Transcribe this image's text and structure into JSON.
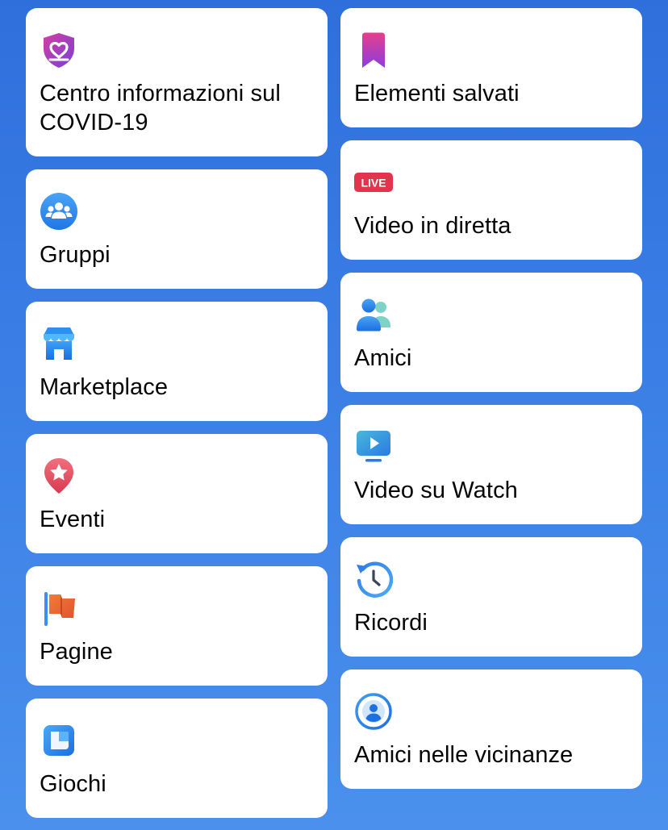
{
  "left_column": [
    {
      "label": "Centro informazioni sul COVID-19",
      "icon": "covid-shield-heart-icon"
    },
    {
      "label": "Gruppi",
      "icon": "groups-icon"
    },
    {
      "label": "Marketplace",
      "icon": "marketplace-shop-icon"
    },
    {
      "label": "Eventi",
      "icon": "events-star-pin-icon"
    },
    {
      "label": "Pagine",
      "icon": "pages-flag-icon"
    },
    {
      "label": "Giochi",
      "icon": "games-icon"
    }
  ],
  "right_column": [
    {
      "label": "Elementi salvati",
      "icon": "saved-bookmark-icon"
    },
    {
      "label": "Video in diretta",
      "icon": "live-badge-icon",
      "badge_text": "LIVE"
    },
    {
      "label": "Amici",
      "icon": "friends-icon"
    },
    {
      "label": "Video su Watch",
      "icon": "watch-video-icon"
    },
    {
      "label": "Ricordi",
      "icon": "memories-clock-icon"
    },
    {
      "label": "Amici nelle vicinanze",
      "icon": "nearby-friends-icon"
    }
  ],
  "colors": {
    "background_top": "#2f6fdc",
    "background_bottom": "#4a90ec",
    "card": "#ffffff",
    "text": "#050505"
  }
}
